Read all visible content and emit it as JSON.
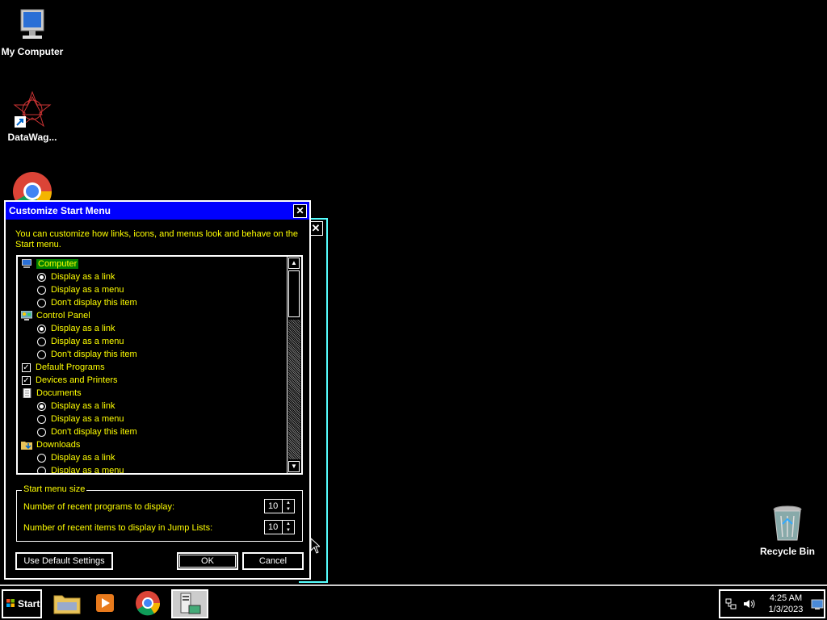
{
  "desktop": {
    "icons": [
      {
        "label": "My Computer"
      },
      {
        "label": "DataWag..."
      },
      {
        "label": "Recycle Bin"
      }
    ]
  },
  "dialog": {
    "title": "Customize Start Menu",
    "description": "You can customize how links, icons, and menus look and behave on the Start menu.",
    "items": [
      {
        "type": "header",
        "label": "Computer",
        "icon": "computer-icon",
        "selected": true
      },
      {
        "type": "radio",
        "label": "Display as a link",
        "checked": true
      },
      {
        "type": "radio",
        "label": "Display as a menu",
        "checked": false
      },
      {
        "type": "radio",
        "label": "Don't display this item",
        "checked": false
      },
      {
        "type": "header",
        "label": "Control Panel",
        "icon": "control-panel-icon"
      },
      {
        "type": "radio",
        "label": "Display as a link",
        "checked": true
      },
      {
        "type": "radio",
        "label": "Display as a menu",
        "checked": false
      },
      {
        "type": "radio",
        "label": "Don't display this item",
        "checked": false
      },
      {
        "type": "checkbox",
        "label": "Default Programs",
        "checked": true
      },
      {
        "type": "checkbox",
        "label": "Devices and Printers",
        "checked": true
      },
      {
        "type": "header",
        "label": "Documents",
        "icon": "documents-icon"
      },
      {
        "type": "radio",
        "label": "Display as a link",
        "checked": true
      },
      {
        "type": "radio",
        "label": "Display as a menu",
        "checked": false
      },
      {
        "type": "radio",
        "label": "Don't display this item",
        "checked": false
      },
      {
        "type": "header",
        "label": "Downloads",
        "icon": "downloads-icon"
      },
      {
        "type": "radio",
        "label": "Display as a link",
        "checked": false
      },
      {
        "type": "radio",
        "label": "Display as a menu",
        "checked": false
      }
    ],
    "size_group": {
      "legend": "Start menu size",
      "recent_programs_label": "Number of recent programs to display:",
      "recent_programs_value": "10",
      "jump_list_label": "Number of recent items to display in Jump Lists:",
      "jump_list_value": "10"
    },
    "buttons": {
      "default_settings": "Use Default Settings",
      "ok": "OK",
      "cancel": "Cancel"
    }
  },
  "taskbar": {
    "start_label": "Start",
    "clock_time": "4:25 AM",
    "clock_date": "1/3/2023"
  },
  "colors": {
    "title_bar": "#0000ff",
    "text": "#ffff00",
    "selected": "#008000"
  }
}
